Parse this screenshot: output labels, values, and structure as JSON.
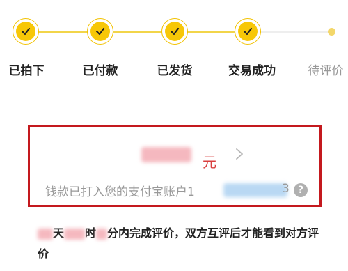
{
  "colors": {
    "accent": "#f7c707",
    "track_done": "#f2d54a",
    "track_pending": "#eeeeee",
    "pending_dot": "#f3d76a",
    "highlight_box": "#c4191e",
    "currency_red": "#d93f3f",
    "muted_text": "#999999",
    "help_icon_bg": "#b0b0b0",
    "redact_pink": "#f5b8bf",
    "redact_blue": "#b9d8f3"
  },
  "progress": {
    "steps": [
      {
        "label": "已拍下",
        "done": true,
        "icon": "check-icon"
      },
      {
        "label": "已付款",
        "done": true,
        "icon": "check-icon"
      },
      {
        "label": "已发货",
        "done": true,
        "icon": "check-icon"
      },
      {
        "label": "交易成功",
        "done": true,
        "icon": "check-icon"
      },
      {
        "label": "待评价",
        "done": false,
        "icon": "pending-dot"
      }
    ]
  },
  "payout": {
    "currency": "元",
    "account_text": "钱款已打入您的支付宝账户",
    "account_prefix": "1",
    "account_suffix": "3",
    "help_icon": "?"
  },
  "note": {
    "part1": "天",
    "part2": "时",
    "part3": "分内完成评价，双方互评后才能看到对方评价"
  }
}
